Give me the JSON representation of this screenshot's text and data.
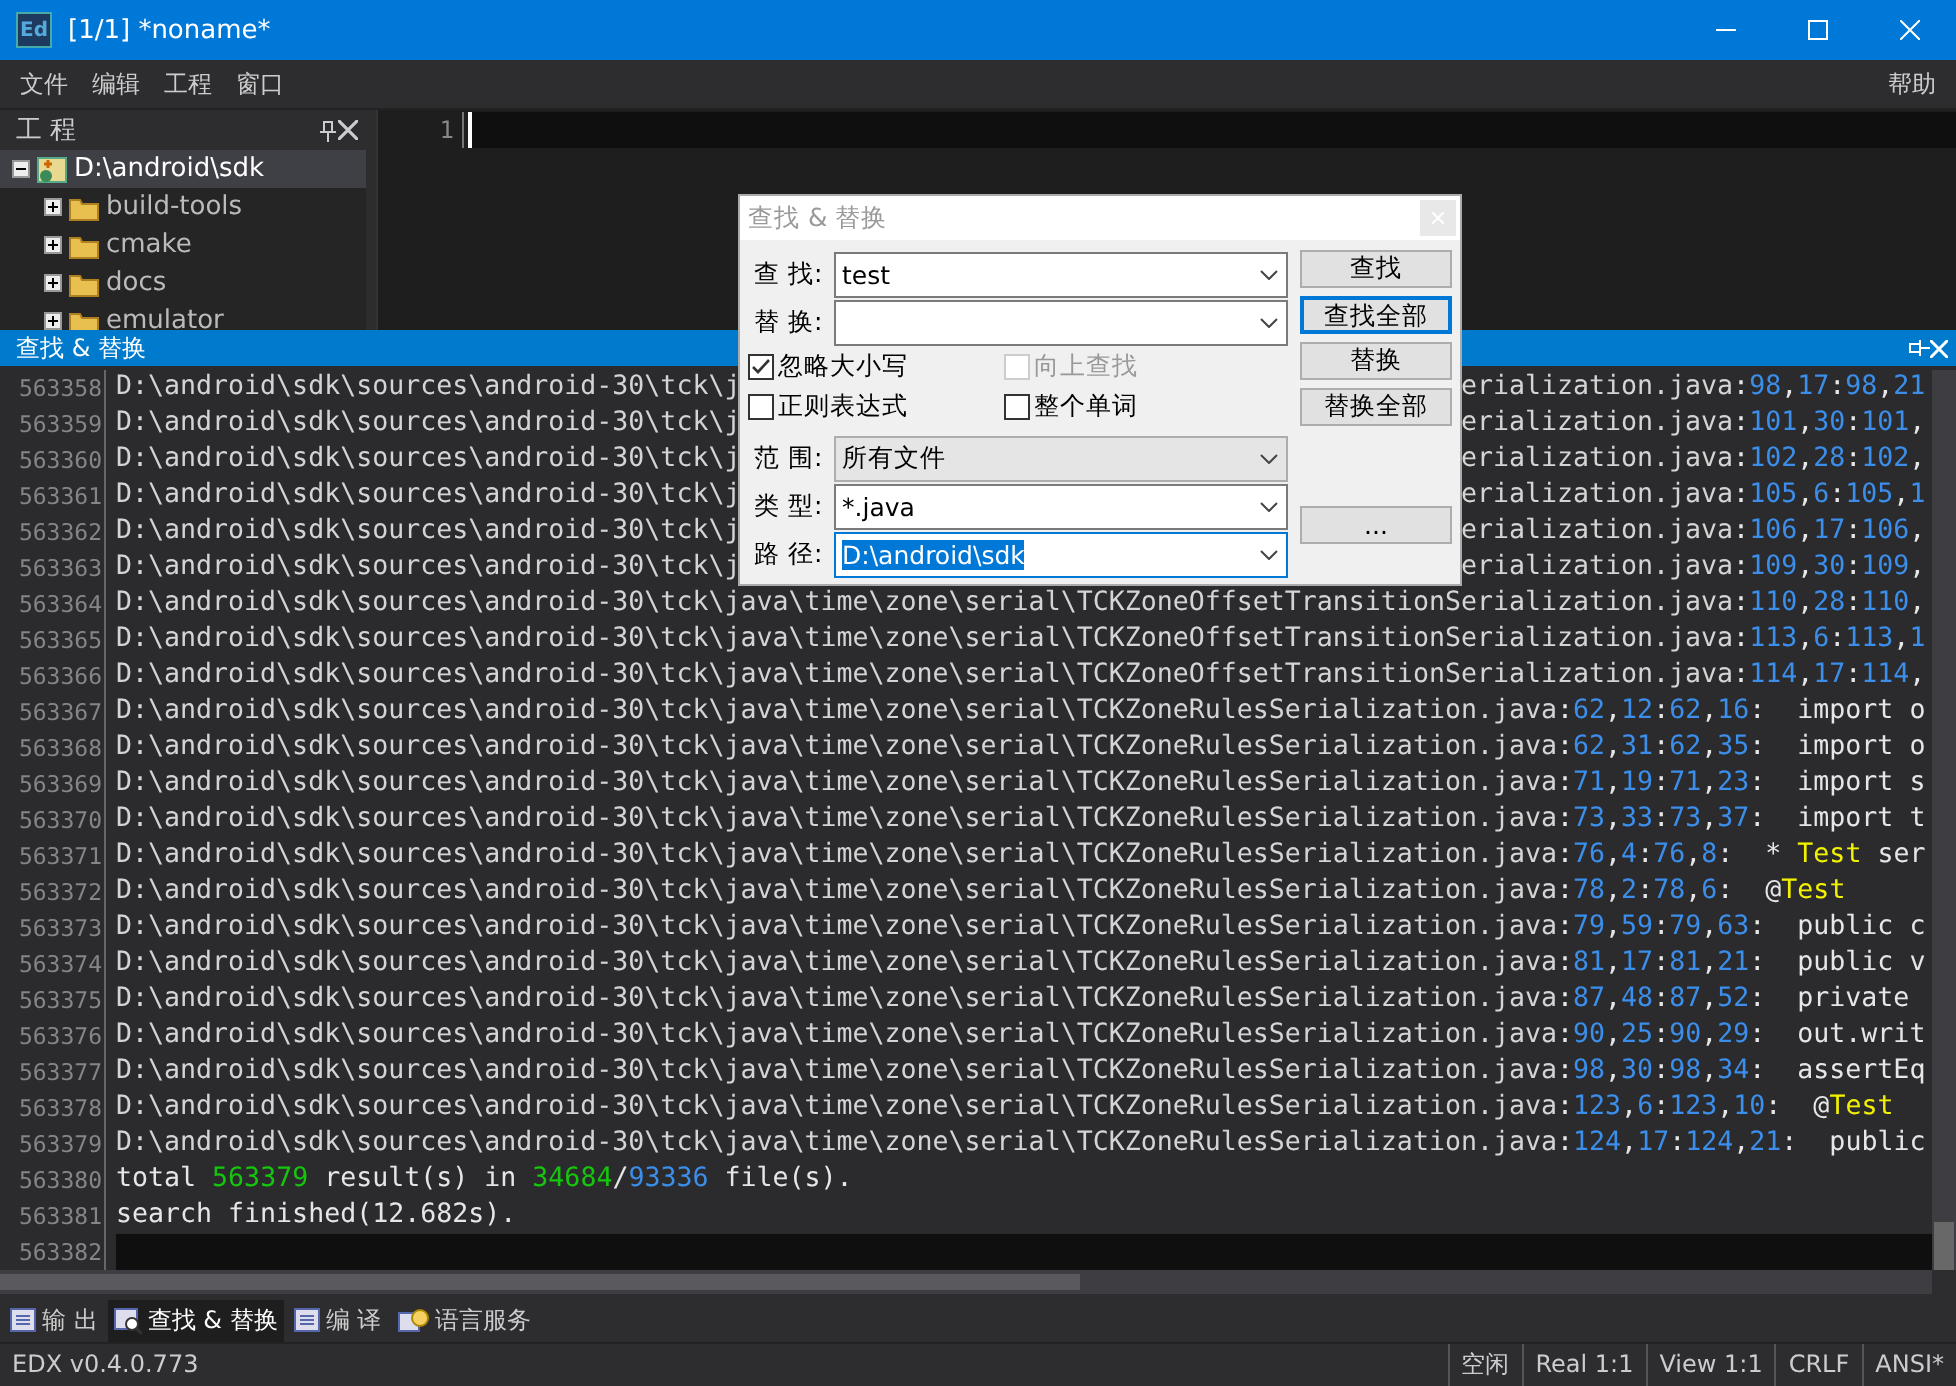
{
  "window": {
    "icon_text": "Ed",
    "title": "[1/1] *noname*"
  },
  "menu": {
    "items": [
      "文件",
      "编辑",
      "工程",
      "窗口"
    ],
    "help": "帮助"
  },
  "project_panel": {
    "title": "工 程",
    "tree": [
      {
        "label": "D:\\android\\sdk",
        "kind": "project",
        "expanded": true,
        "selected": true,
        "children": [
          {
            "label": "build-tools",
            "kind": "folder",
            "expanded": false,
            "selected": false
          },
          {
            "label": "cmake",
            "kind": "folder",
            "expanded": false,
            "selected": false
          },
          {
            "label": "docs",
            "kind": "folder",
            "expanded": false,
            "selected": false
          },
          {
            "label": "emulator",
            "kind": "folder",
            "expanded": false,
            "selected": false
          }
        ]
      }
    ]
  },
  "editor": {
    "lines": [
      {
        "number": "1",
        "current": true
      }
    ]
  },
  "results_panel": {
    "title": "查找 & 替换",
    "rows": [
      {
        "number": "563358",
        "current": false,
        "segments": [
          {
            "kind": "path",
            "text": "D:\\android\\sdk\\sources\\android-30\\tck\\j"
          }
        ],
        "tail": [
          {
            "kind": "path",
            "text": "erialization.java"
          },
          {
            "kind": "loc",
            "text": ":98,17:98,21"
          }
        ]
      },
      {
        "number": "563359",
        "current": false,
        "segments": [
          {
            "kind": "path",
            "text": "D:\\android\\sdk\\sources\\android-30\\tck\\j"
          }
        ],
        "tail": [
          {
            "kind": "path",
            "text": "erialization.java"
          },
          {
            "kind": "loc",
            "text": ":101,30:101,"
          }
        ]
      },
      {
        "number": "563360",
        "current": false,
        "segments": [
          {
            "kind": "path",
            "text": "D:\\android\\sdk\\sources\\android-30\\tck\\j"
          }
        ],
        "tail": [
          {
            "kind": "path",
            "text": "erialization.java"
          },
          {
            "kind": "loc",
            "text": ":102,28:102,"
          }
        ]
      },
      {
        "number": "563361",
        "current": false,
        "segments": [
          {
            "kind": "path",
            "text": "D:\\android\\sdk\\sources\\android-30\\tck\\j"
          }
        ],
        "tail": [
          {
            "kind": "path",
            "text": "erialization.java"
          },
          {
            "kind": "loc",
            "text": ":105,6:105,1"
          }
        ]
      },
      {
        "number": "563362",
        "current": false,
        "segments": [
          {
            "kind": "path",
            "text": "D:\\android\\sdk\\sources\\android-30\\tck\\j"
          }
        ],
        "tail": [
          {
            "kind": "path",
            "text": "erialization.java"
          },
          {
            "kind": "loc",
            "text": ":106,17:106,"
          }
        ]
      },
      {
        "number": "563363",
        "current": false,
        "segments": [
          {
            "kind": "path",
            "text": "D:\\android\\sdk\\sources\\android-30\\tck\\j"
          }
        ],
        "tail": [
          {
            "kind": "path",
            "text": "erialization.java"
          },
          {
            "kind": "loc",
            "text": ":109,30:109,"
          }
        ]
      },
      {
        "number": "563364",
        "current": false,
        "segments": [
          {
            "kind": "path",
            "text": "D:\\android\\sdk\\sources\\android-30\\tck\\java\\time\\zone\\serial\\TCKZoneOffsetTransitionSerialization.java"
          },
          {
            "kind": "loc",
            "text": ":110,28:110,"
          }
        ]
      },
      {
        "number": "563365",
        "current": false,
        "segments": [
          {
            "kind": "path",
            "text": "D:\\android\\sdk\\sources\\android-30\\tck\\java\\time\\zone\\serial\\TCKZoneOffsetTransitionSerialization.java"
          },
          {
            "kind": "loc",
            "text": ":113,6:113,1"
          }
        ]
      },
      {
        "number": "563366",
        "current": false,
        "segments": [
          {
            "kind": "path",
            "text": "D:\\android\\sdk\\sources\\android-30\\tck\\java\\time\\zone\\serial\\TCKZoneOffsetTransitionSerialization.java"
          },
          {
            "kind": "loc",
            "text": ":114,17:114,"
          }
        ]
      },
      {
        "number": "563367",
        "current": false,
        "segments": [
          {
            "kind": "path",
            "text": "D:\\android\\sdk\\sources\\android-30\\tck\\java\\time\\zone\\serial\\TCKZoneRulesSerialization.java"
          },
          {
            "kind": "loc",
            "text": ":62,12:62,16:"
          },
          {
            "kind": "code",
            "text": "  import o"
          }
        ]
      },
      {
        "number": "563368",
        "current": false,
        "segments": [
          {
            "kind": "path",
            "text": "D:\\android\\sdk\\sources\\android-30\\tck\\java\\time\\zone\\serial\\TCKZoneRulesSerialization.java"
          },
          {
            "kind": "loc",
            "text": ":62,31:62,35:"
          },
          {
            "kind": "code",
            "text": "  import o"
          }
        ]
      },
      {
        "number": "563369",
        "current": false,
        "segments": [
          {
            "kind": "path",
            "text": "D:\\android\\sdk\\sources\\android-30\\tck\\java\\time\\zone\\serial\\TCKZoneRulesSerialization.java"
          },
          {
            "kind": "loc",
            "text": ":71,19:71,23:"
          },
          {
            "kind": "code",
            "text": "  import s"
          }
        ]
      },
      {
        "number": "563370",
        "current": false,
        "segments": [
          {
            "kind": "path",
            "text": "D:\\android\\sdk\\sources\\android-30\\tck\\java\\time\\zone\\serial\\TCKZoneRulesSerialization.java"
          },
          {
            "kind": "loc",
            "text": ":73,33:73,37:"
          },
          {
            "kind": "code",
            "text": "  import t"
          }
        ]
      },
      {
        "number": "563371",
        "current": false,
        "segments": [
          {
            "kind": "path",
            "text": "D:\\android\\sdk\\sources\\android-30\\tck\\java\\time\\zone\\serial\\TCKZoneRulesSerialization.java"
          },
          {
            "kind": "loc",
            "text": ":76,4:76,8:"
          },
          {
            "kind": "code",
            "text": "  * "
          },
          {
            "kind": "match",
            "text": "Test"
          },
          {
            "kind": "code",
            "text": " ser"
          }
        ]
      },
      {
        "number": "563372",
        "current": false,
        "segments": [
          {
            "kind": "path",
            "text": "D:\\android\\sdk\\sources\\android-30\\tck\\java\\time\\zone\\serial\\TCKZoneRulesSerialization.java"
          },
          {
            "kind": "loc",
            "text": ":78,2:78,6:"
          },
          {
            "kind": "code",
            "text": "  @"
          },
          {
            "kind": "match",
            "text": "Test"
          }
        ]
      },
      {
        "number": "563373",
        "current": false,
        "segments": [
          {
            "kind": "path",
            "text": "D:\\android\\sdk\\sources\\android-30\\tck\\java\\time\\zone\\serial\\TCKZoneRulesSerialization.java"
          },
          {
            "kind": "loc",
            "text": ":79,59:79,63:"
          },
          {
            "kind": "code",
            "text": "  public c"
          }
        ]
      },
      {
        "number": "563374",
        "current": false,
        "segments": [
          {
            "kind": "path",
            "text": "D:\\android\\sdk\\sources\\android-30\\tck\\java\\time\\zone\\serial\\TCKZoneRulesSerialization.java"
          },
          {
            "kind": "loc",
            "text": ":81,17:81,21:"
          },
          {
            "kind": "code",
            "text": "  public v"
          }
        ]
      },
      {
        "number": "563375",
        "current": false,
        "segments": [
          {
            "kind": "path",
            "text": "D:\\android\\sdk\\sources\\android-30\\tck\\java\\time\\zone\\serial\\TCKZoneRulesSerialization.java"
          },
          {
            "kind": "loc",
            "text": ":87,48:87,52:"
          },
          {
            "kind": "code",
            "text": "  private"
          }
        ]
      },
      {
        "number": "563376",
        "current": false,
        "segments": [
          {
            "kind": "path",
            "text": "D:\\android\\sdk\\sources\\android-30\\tck\\java\\time\\zone\\serial\\TCKZoneRulesSerialization.java"
          },
          {
            "kind": "loc",
            "text": ":90,25:90,29:"
          },
          {
            "kind": "code",
            "text": "  out.writ"
          }
        ]
      },
      {
        "number": "563377",
        "current": false,
        "segments": [
          {
            "kind": "path",
            "text": "D:\\android\\sdk\\sources\\android-30\\tck\\java\\time\\zone\\serial\\TCKZoneRulesSerialization.java"
          },
          {
            "kind": "loc",
            "text": ":98,30:98,34:"
          },
          {
            "kind": "code",
            "text": "  assertEq"
          }
        ]
      },
      {
        "number": "563378",
        "current": false,
        "segments": [
          {
            "kind": "path",
            "text": "D:\\android\\sdk\\sources\\android-30\\tck\\java\\time\\zone\\serial\\TCKZoneRulesSerialization.java"
          },
          {
            "kind": "loc",
            "text": ":123,6:123,10:"
          },
          {
            "kind": "code",
            "text": "  @"
          },
          {
            "kind": "match",
            "text": "Test"
          }
        ]
      },
      {
        "number": "563379",
        "current": false,
        "segments": [
          {
            "kind": "path",
            "text": "D:\\android\\sdk\\sources\\android-30\\tck\\java\\time\\zone\\serial\\TCKZoneRulesSerialization.java"
          },
          {
            "kind": "loc",
            "text": ":124,17:124,21:"
          },
          {
            "kind": "code",
            "text": "  public"
          }
        ]
      },
      {
        "number": "563380",
        "current": false,
        "segments": [
          {
            "kind": "code",
            "text": "total "
          },
          {
            "kind": "count",
            "text": "563379"
          },
          {
            "kind": "code",
            "text": " result(s) in "
          },
          {
            "kind": "count",
            "text": "34684"
          },
          {
            "kind": "code",
            "text": "/"
          },
          {
            "kind": "total",
            "text": "93336"
          },
          {
            "kind": "code",
            "text": " file(s)."
          }
        ]
      },
      {
        "number": "563381",
        "current": false,
        "segments": [
          {
            "kind": "code",
            "text": "search finished(12.682s)."
          }
        ]
      },
      {
        "number": "563382",
        "current": true,
        "segments": []
      }
    ]
  },
  "find_dialog": {
    "title": "查找 & 替换",
    "fields": [
      {
        "label": "查 找:",
        "kind": "combo",
        "value": "test",
        "value_selected": false
      },
      {
        "label": "替 换:",
        "kind": "combo",
        "value_selected": false
      }
    ],
    "options": [
      {
        "label": "忽略大小写",
        "checked": true,
        "disabled": false
      },
      {
        "label": "向上查找",
        "checked": false,
        "disabled": true
      },
      {
        "label": "正则表达式",
        "checked": false,
        "disabled": false
      },
      {
        "label": "整个单词",
        "checked": false,
        "disabled": false
      }
    ],
    "scope_fields": [
      {
        "label": "范 围:",
        "kind": "select",
        "value": "所有文件",
        "value_selected": false
      },
      {
        "label": "类 型:",
        "kind": "combo",
        "value": "*.java",
        "value_selected": false
      },
      {
        "label": "路 径:",
        "kind": "combo",
        "value": "D:\\android\\sdk",
        "value_selected": true
      }
    ],
    "buttons": [
      {
        "label": "查找",
        "default": false
      },
      {
        "label": "查找全部",
        "default": true
      },
      {
        "label": "替换",
        "default": false
      },
      {
        "label": "替换全部",
        "default": false
      }
    ],
    "browse_button": "..."
  },
  "bottom_tabs": [
    {
      "label": "输 出",
      "kind": "output",
      "selected": false
    },
    {
      "label": "查找 & 替换",
      "kind": "search",
      "selected": true
    },
    {
      "label": "编 译",
      "kind": "output",
      "selected": false
    },
    {
      "label": "语言服务",
      "kind": "service",
      "selected": false
    }
  ],
  "status_bar": [
    "EDX v0.4.0.773",
    "空闲",
    "Real 1:1",
    "View 1:1",
    "CRLF",
    "ANSI*"
  ]
}
